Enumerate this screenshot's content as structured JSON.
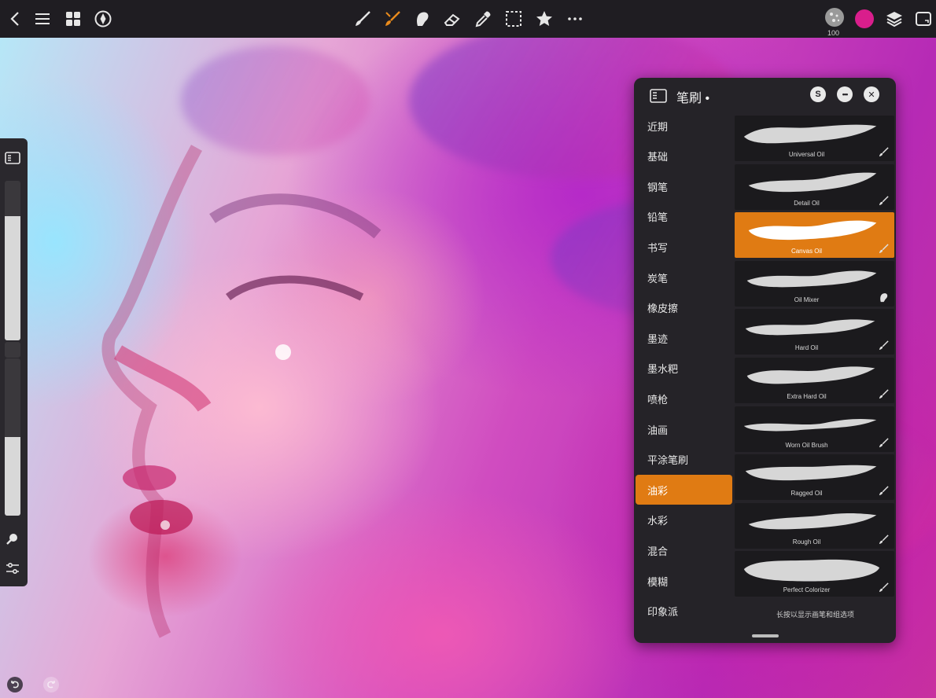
{
  "toolbar": {
    "left_icons": [
      "back-icon",
      "menu-icon",
      "gallery-icon",
      "adjust-icon"
    ],
    "tools": [
      "brush-icon",
      "smudge-icon",
      "smudge-finger-icon",
      "eraser-icon",
      "eyedropper-icon",
      "selection-icon",
      "transform-icon",
      "more-icon"
    ],
    "active_tool": "smudge-icon",
    "brush_size": "100",
    "current_color": "#d91e8c",
    "accent": "#e07b13"
  },
  "sidebar": {
    "size_level": 0.78,
    "opacity_level": 0.5
  },
  "panel": {
    "title": "笔刷 •",
    "header_buttons": [
      "S",
      "•••",
      "✕"
    ],
    "categories": [
      {
        "label": "近期"
      },
      {
        "label": "基础"
      },
      {
        "label": "钢笔"
      },
      {
        "label": "铅笔"
      },
      {
        "label": "书写"
      },
      {
        "label": "炭笔"
      },
      {
        "label": "橡皮擦"
      },
      {
        "label": "墨迹"
      },
      {
        "label": "墨水粑"
      },
      {
        "label": "喷枪"
      },
      {
        "label": "油画"
      },
      {
        "label": "平涂笔刷"
      },
      {
        "label": "油彩"
      },
      {
        "label": "水彩"
      },
      {
        "label": "混合"
      },
      {
        "label": "模糊"
      },
      {
        "label": "印象派"
      }
    ],
    "active_category": "油彩",
    "brushes": [
      {
        "name": "Universal Oil",
        "tool": "brush"
      },
      {
        "name": "Detail Oil",
        "tool": "brush"
      },
      {
        "name": "Canvas Oil",
        "tool": "brush"
      },
      {
        "name": "Oil Mixer",
        "tool": "smudge"
      },
      {
        "name": "Hard Oil",
        "tool": "brush"
      },
      {
        "name": "Extra Hard Oil",
        "tool": "brush"
      },
      {
        "name": "Worn Oil Brush",
        "tool": "brush"
      },
      {
        "name": "Ragged Oil",
        "tool": "brush"
      },
      {
        "name": "Rough Oil",
        "tool": "brush"
      },
      {
        "name": "Perfect Colorizer",
        "tool": "brush"
      }
    ],
    "active_brush": "Canvas Oil",
    "hint": "长按以显示画笔和组选项"
  }
}
